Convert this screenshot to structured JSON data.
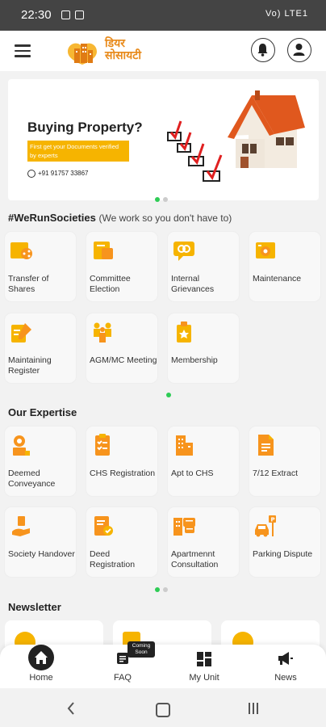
{
  "status_bar": {
    "time": "22:30",
    "right_text": "Vo) LTE1"
  },
  "app": {
    "logo_line1": "डियर",
    "logo_line2": "सोसायटी"
  },
  "banner": {
    "title": "Buying Property?",
    "subtitle": "First get your Documents verified by experts",
    "phone": "+91 91757 33867"
  },
  "services": {
    "title": "#WeRunSocieties",
    "subtitle": "(We work so you don't have to)",
    "items": [
      {
        "label": "Transfer of Shares",
        "icon": "share-transfer-icon"
      },
      {
        "label": "Committee Election",
        "icon": "election-icon"
      },
      {
        "label": "Internal Grievances",
        "icon": "grievance-icon"
      },
      {
        "label": "Maintenance",
        "icon": "maintenance-icon"
      },
      {
        "label": "Maintaining Register",
        "icon": "register-icon"
      },
      {
        "label": "AGM/MC Meeting",
        "icon": "meeting-icon"
      },
      {
        "label": "Membership",
        "icon": "membership-icon"
      }
    ]
  },
  "expertise": {
    "title": "Our Expertise",
    "items": [
      {
        "label": "Deemed Conveyance",
        "icon": "conveyance-icon"
      },
      {
        "label": "CHS Registration",
        "icon": "chs-registration-icon"
      },
      {
        "label": "Apt to CHS",
        "icon": "building-icon"
      },
      {
        "label": "7/12 Extract",
        "icon": "document-icon"
      },
      {
        "label": "Society Handover",
        "icon": "handover-icon"
      },
      {
        "label": "Deed Registration",
        "icon": "deed-icon"
      },
      {
        "label": "Apartmennt Consultation",
        "icon": "consultation-icon"
      },
      {
        "label": "Parking Dispute",
        "icon": "parking-icon"
      }
    ]
  },
  "newsletter": {
    "title": "Newsletter"
  },
  "bottom_nav": {
    "items": [
      {
        "label": "Home",
        "icon": "home-icon"
      },
      {
        "label": "FAQ",
        "icon": "faq-icon"
      },
      {
        "label": "My Unit",
        "icon": "unit-grid-icon"
      },
      {
        "label": "News",
        "icon": "megaphone-icon"
      }
    ],
    "coming_soon": "Coming Soon"
  },
  "colors": {
    "accent": "#f7941d",
    "yellow": "#f6b400",
    "dot_active": "#2ecc55"
  }
}
